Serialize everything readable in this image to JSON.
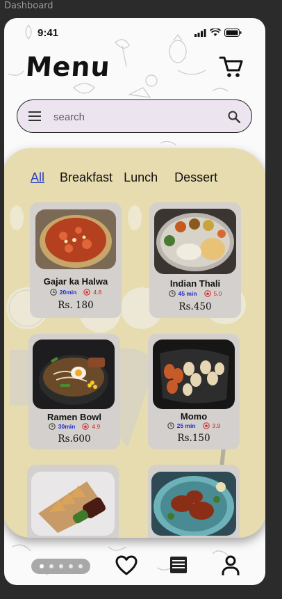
{
  "frame_label": "Dashboard",
  "status_bar": {
    "time": "9:41"
  },
  "header": {
    "title": "Menu",
    "cart_icon": "cart-icon"
  },
  "search": {
    "placeholder": "search",
    "menu_icon": "menu-icon",
    "search_icon": "search-icon"
  },
  "tabs": [
    {
      "label": "All",
      "active": true
    },
    {
      "label": "Breakfast",
      "active": false
    },
    {
      "label": "Lunch",
      "active": false
    },
    {
      "label": "Dessert",
      "active": false
    }
  ],
  "items": [
    {
      "name": "Gajar ka Halwa",
      "time": "20min",
      "rating": "4.8",
      "price": "Rs. 180"
    },
    {
      "name": "Indian Thali",
      "time": "45 min",
      "rating": "5.0",
      "price": "Rs.450"
    },
    {
      "name": "Ramen Bowl",
      "time": "30min",
      "rating": "4.9",
      "price": "Rs.600"
    },
    {
      "name": "Momo",
      "time": "25 min",
      "rating": "3.9",
      "price": "Rs.150"
    },
    {
      "name": "",
      "time": "",
      "rating": "",
      "price": ""
    },
    {
      "name": "",
      "time": "",
      "rating": "",
      "price": ""
    }
  ],
  "bottom_nav": {
    "page_count": 5,
    "active_page": 1,
    "icons": [
      "heart-icon",
      "list-icon",
      "user-icon"
    ]
  },
  "colors": {
    "accent": "#2a3fc9",
    "panel": "#e6dcaf",
    "card": "#d3d0cd",
    "search_bg": "#ece4ef",
    "rating": "#d12626"
  }
}
